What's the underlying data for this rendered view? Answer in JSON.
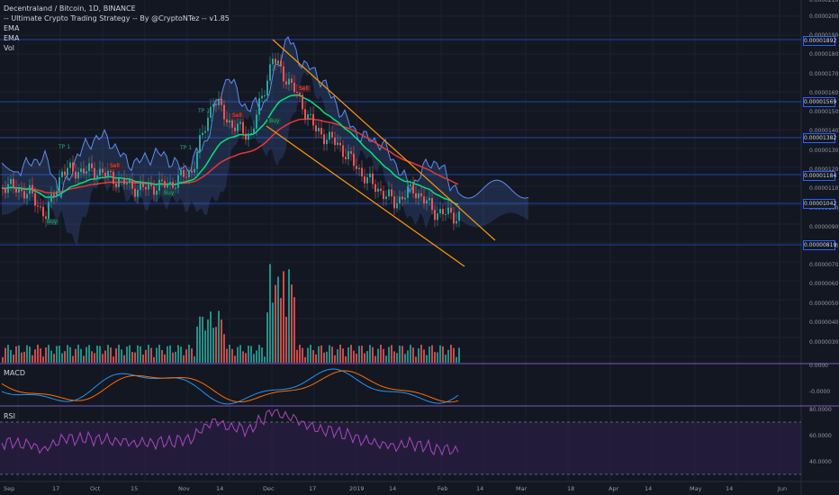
{
  "legend": {
    "title": "Decentraland / Bitcoin, 1D, BINANCE",
    "strategy": "-- Ultimate Crypto Trading Strategy -- By @CryptoNTez -- v1.85",
    "ema1": "EMA",
    "ema2": "EMA",
    "vol": "Vol"
  },
  "panes": {
    "macd": "MACD",
    "rsi": "RSI"
  },
  "price_axis": [
    "0.00002100",
    "0.00002000",
    "0.00001900",
    "0.00001800",
    "0.00001700",
    "0.00001600",
    "0.00001500",
    "0.00001400",
    "0.00001300",
    "0.00001200",
    "0.00001100",
    "0.00001000",
    "0.00000900",
    "0.00000800",
    "0.00000700",
    "0.00000600",
    "0.00000500",
    "0.00000400",
    "0.00000300"
  ],
  "price_tags": [
    "0.00001892",
    "0.00001569",
    "0.00001382",
    "0.00001184",
    "0.00001042",
    "0.00000819"
  ],
  "macd_axis": [
    "0.0000",
    "-0.0000"
  ],
  "rsi_axis": [
    "80.0000",
    "60.0000",
    "40.0000"
  ],
  "time_axis": [
    "Sep",
    "17",
    "Oct",
    "15",
    "Nov",
    "14",
    "Dec",
    "17",
    "2019",
    "14",
    "Feb",
    "14",
    "Mar",
    "18",
    "Apr",
    "14",
    "May",
    "14",
    "Jun"
  ],
  "signals": {
    "tp1": "TP 1",
    "sell": "Sell",
    "buy": "Buy",
    "tp1b": "TP 1",
    "tp1c": "TP 1"
  },
  "colors": {
    "background": "#131722",
    "up": "#26a69a",
    "down": "#ef5350",
    "ema_fast": "#00e676",
    "ema_slow": "#e53935",
    "cloud": "#5b8def",
    "trendline": "#ff9800",
    "level": "#2962ff",
    "pane_sep": "#7e57c2",
    "rsi": "#ab47bc"
  }
}
